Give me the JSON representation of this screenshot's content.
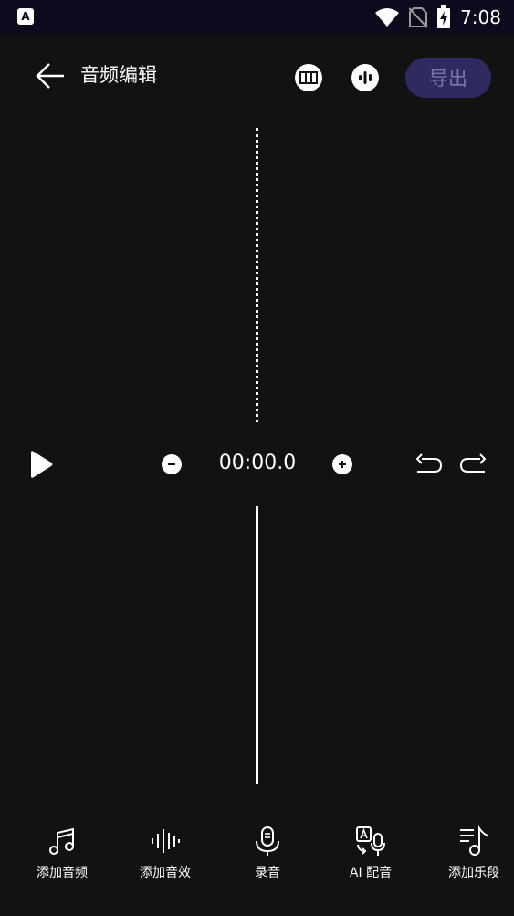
{
  "status_bar": {
    "time": "7:08",
    "app_badge": "A"
  },
  "header": {
    "title": "音频编辑",
    "export_label": "导出"
  },
  "controls": {
    "time": "00:00.0"
  },
  "toolbar": {
    "items": [
      {
        "label": "添加音频",
        "icon": "music-note-icon"
      },
      {
        "label": "添加音效",
        "icon": "sound-wave-icon"
      },
      {
        "label": "录音",
        "icon": "microphone-icon"
      },
      {
        "label": "AI 配音",
        "icon": "ai-dub-icon"
      },
      {
        "label": "添加乐段",
        "icon": "playlist-music-icon"
      }
    ]
  },
  "colors": {
    "background": "#121212",
    "status_bar": "#0c0a1c",
    "export_bg": "#2e2b63",
    "export_text": "#7a78b0"
  }
}
